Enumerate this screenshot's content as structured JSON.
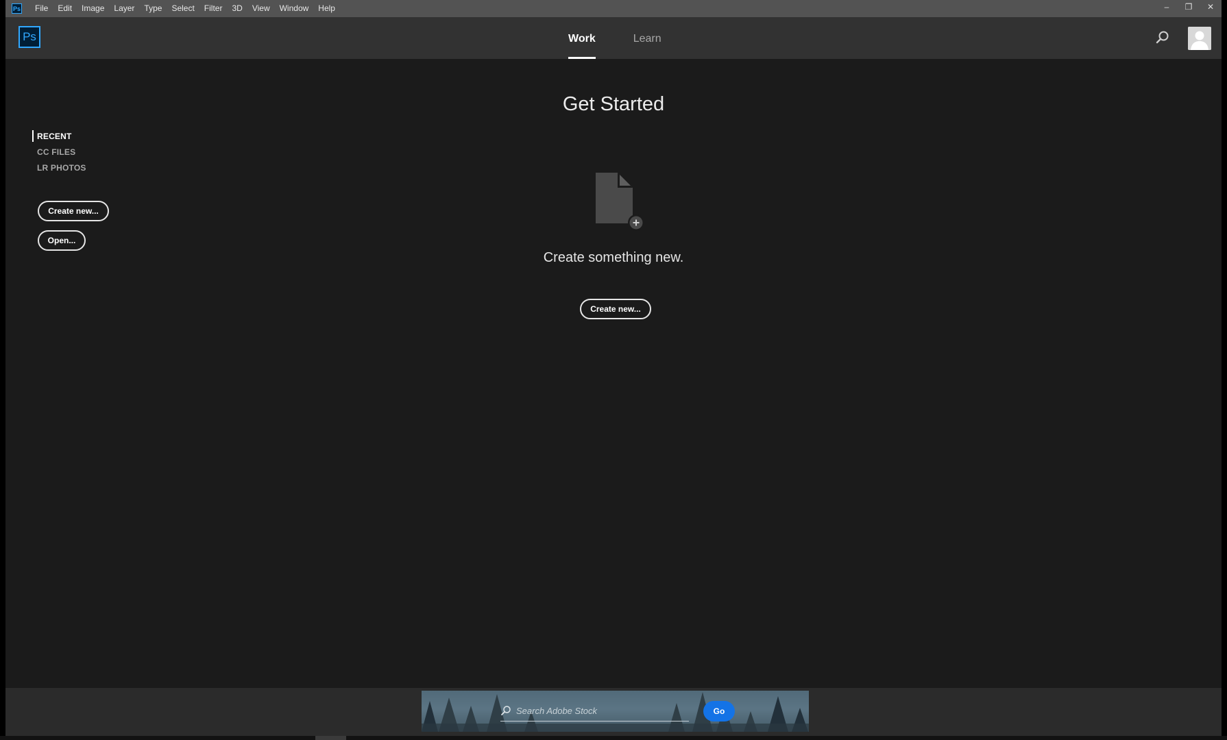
{
  "menubar": {
    "app_icon": "Ps",
    "items": [
      "File",
      "Edit",
      "Image",
      "Layer",
      "Type",
      "Select",
      "Filter",
      "3D",
      "View",
      "Window",
      "Help"
    ],
    "controls": {
      "minimize": "–",
      "restore": "❐",
      "close": "✕"
    }
  },
  "header": {
    "logo": "Ps",
    "tabs": [
      {
        "label": "Work",
        "active": true
      },
      {
        "label": "Learn",
        "active": false
      }
    ]
  },
  "leftnav": {
    "items": [
      {
        "label": "RECENT",
        "active": true
      },
      {
        "label": "CC FILES",
        "active": false
      },
      {
        "label": "LR PHOTOS",
        "active": false
      }
    ],
    "create_label": "Create new...",
    "open_label": "Open..."
  },
  "main": {
    "title": "Get Started",
    "subtitle": "Create something new.",
    "create_label": "Create new..."
  },
  "footer": {
    "search_placeholder": "Search Adobe Stock",
    "go_label": "Go"
  },
  "colors": {
    "background": "#1b1b1b",
    "header": "#323232",
    "menubar": "#535353",
    "accent": "#31a8ff",
    "go_button": "#1473e6"
  },
  "icons": [
    "search-icon",
    "avatar-icon",
    "new-document-icon",
    "plus-icon",
    "minimize-icon",
    "restore-icon",
    "close-icon"
  ]
}
